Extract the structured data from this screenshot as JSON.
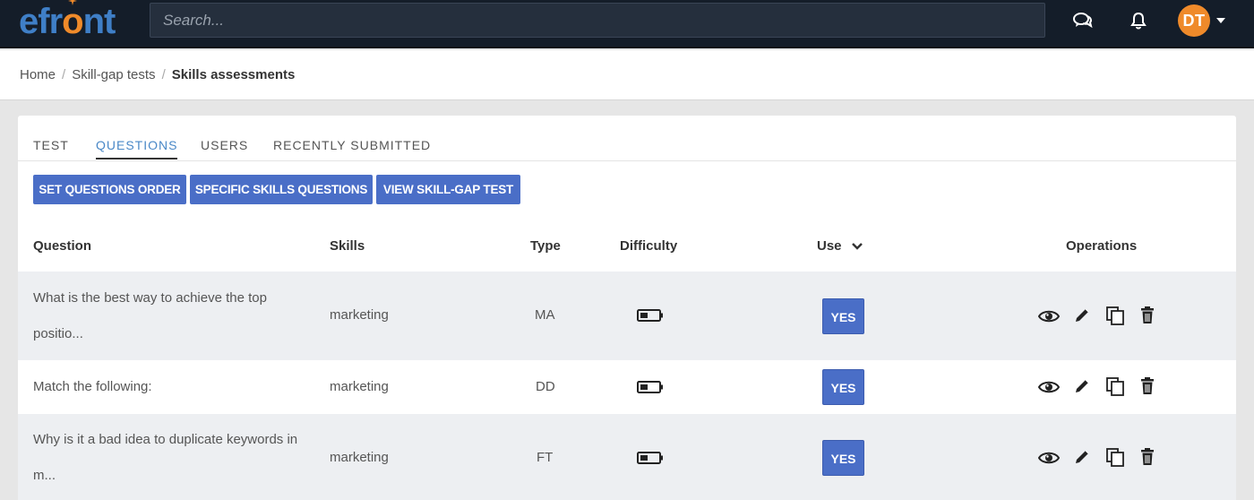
{
  "header": {
    "logo_text_before": "efr",
    "logo_text_o": "o",
    "logo_text_after": "nt",
    "search_placeholder": "Search...",
    "avatar_initials": "DT",
    "icons": [
      "chat-bubbles-icon",
      "bell-icon",
      "caret-down-icon"
    ]
  },
  "breadcrumb": {
    "items": [
      "Home",
      "Skill-gap tests"
    ],
    "current": "Skills assessments"
  },
  "tabs": [
    {
      "label": "TEST",
      "active": false
    },
    {
      "label": "QUESTIONS",
      "active": true
    },
    {
      "label": "USERS",
      "active": false
    },
    {
      "label": "RECENTLY SUBMITTED",
      "active": false
    }
  ],
  "actions": {
    "set_order": "SET QUESTIONS ORDER",
    "specific_skills": "SPECIFIC SKILLS QUESTIONS",
    "view_test": "VIEW SKILL-GAP TEST"
  },
  "table": {
    "columns": {
      "question": "Question",
      "skills": "Skills",
      "type": "Type",
      "difficulty": "Difficulty",
      "use": "Use",
      "operations": "Operations"
    },
    "rows": [
      {
        "question": "What is the best way to achieve the top positio...",
        "skills": "marketing",
        "type": "MA",
        "difficulty_icon": "battery-low-icon",
        "use": "YES"
      },
      {
        "question": "Match the following:",
        "skills": "marketing",
        "type": "DD",
        "difficulty_icon": "battery-low-icon",
        "use": "YES"
      },
      {
        "question": "Why is it a bad idea to duplicate keywords in m...",
        "skills": "marketing",
        "type": "FT",
        "difficulty_icon": "battery-low-icon",
        "use": "YES"
      }
    ],
    "operation_icons": [
      "eye-icon",
      "pencil-icon",
      "copy-icon",
      "trash-icon"
    ]
  },
  "colors": {
    "topbar": "#141d29",
    "brand_blue": "#3f7fc7",
    "brand_orange": "#ef8a2a",
    "button": "#4a6ec7",
    "active_tab": "#4a88c7",
    "row_shade": "#edeff2"
  }
}
